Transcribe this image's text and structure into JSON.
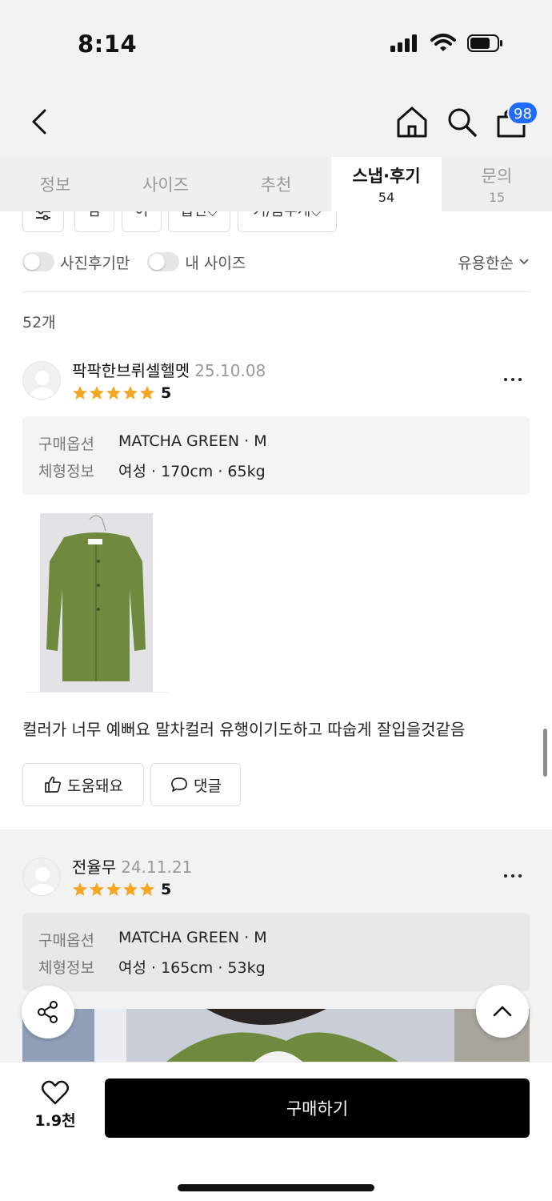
{
  "status": {
    "time": "8:14"
  },
  "header": {
    "cart_badge": "98",
    "icons": [
      "chevron-left-icon",
      "home-icon",
      "search-icon",
      "bag-icon"
    ]
  },
  "tabs": [
    {
      "label": "정보",
      "count": ""
    },
    {
      "label": "사이즈",
      "count": ""
    },
    {
      "label": "추천",
      "count": ""
    },
    {
      "label": "스냅·후기",
      "count": "54",
      "active": true
    },
    {
      "label": "문의",
      "count": "15"
    }
  ],
  "filters": {
    "chips": [
      "",
      "남",
      "여",
      "옵션",
      "키/몸무게"
    ]
  },
  "toggles": {
    "photo_only": "사진후기만",
    "my_size": "내 사이즈"
  },
  "sort": {
    "label": "유용한순"
  },
  "review_count": "52개",
  "reviews": [
    {
      "name": "팍팍한브뤼셀헬멧",
      "date": "25.10.08",
      "rating": "5",
      "option_key": "구매옵션",
      "option_val": "MATCHA GREEN · M",
      "body_key": "체형정보",
      "body_val": "여성 · 170cm · 65kg",
      "text": "컬러가 너무 예뻐요 말차컬러 유행이기도하고 따숩게 잘입을것같음",
      "helpful_label": "도움돼요",
      "comment_label": "댓글"
    },
    {
      "name": "전율무",
      "date": "24.11.21",
      "rating": "5",
      "option_key": "구매옵션",
      "option_val": "MATCHA GREEN · M",
      "body_key": "체형정보",
      "body_val": "여성 · 165cm · 53kg"
    }
  ],
  "bottom": {
    "like_count": "1.9천",
    "buy_label": "구매하기"
  },
  "colors": {
    "accent_badge": "#1f6bff",
    "star": "#f5a623",
    "buy": "#000000"
  }
}
